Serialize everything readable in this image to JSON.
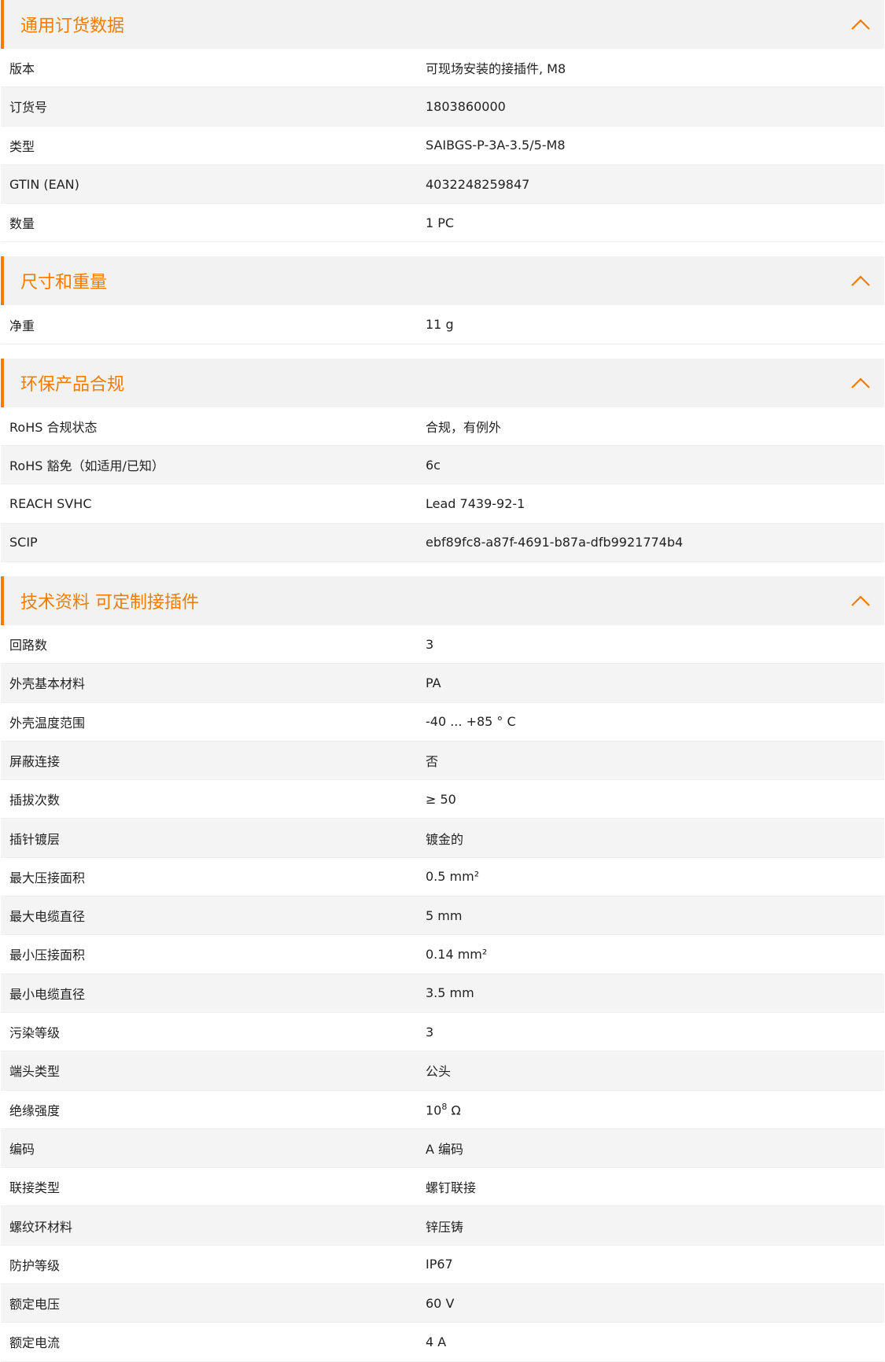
{
  "accent_color": "#f07c00",
  "sections": [
    {
      "title": "通用订货数据",
      "rows": [
        {
          "label": "版本",
          "value": "可现场安装的接插件, M8"
        },
        {
          "label": "订货号",
          "value": "1803860000"
        },
        {
          "label": "类型",
          "value": "SAIBGS-P-3A-3.5/5-M8"
        },
        {
          "label": "GTIN (EAN)",
          "value": "4032248259847"
        },
        {
          "label": "数量",
          "value": "1  PC"
        }
      ]
    },
    {
      "title": "尺寸和重量",
      "rows": [
        {
          "label": "净重",
          "value": "11  g"
        }
      ]
    },
    {
      "title": "环保产品合规",
      "rows": [
        {
          "label": "RoHS 合规状态",
          "value": "合规，有例外"
        },
        {
          "label": "RoHS 豁免（如适用/已知）",
          "value": "6c"
        },
        {
          "label": "REACH SVHC",
          "value": "Lead 7439-92-1"
        },
        {
          "label": "SCIP",
          "value": "ebf89fc8-a87f-4691-b87a-dfb9921774b4"
        }
      ]
    },
    {
      "title": "技术资料 可定制接插件",
      "rows": [
        {
          "label": "回路数",
          "value": "3"
        },
        {
          "label": "外壳基本材料",
          "value": "PA"
        },
        {
          "label": "外壳温度范围",
          "value": "-40 ... +85 ° C"
        },
        {
          "label": "屏蔽连接",
          "value": "否"
        },
        {
          "label": "插拔次数",
          "value": "≥ 50"
        },
        {
          "label": "插针镀层",
          "value": "镀金的"
        },
        {
          "label": "最大压接面积",
          "value": "0.5  mm²"
        },
        {
          "label": "最大电缆直径",
          "value": "5  mm"
        },
        {
          "label": "最小压接面积",
          "value": "0.14  mm²"
        },
        {
          "label": "最小电缆直径",
          "value": "3.5  mm"
        },
        {
          "label": "污染等级",
          "value": "3"
        },
        {
          "label": "端头类型",
          "value": "公头"
        },
        {
          "label": "绝缘强度",
          "value_base": "10",
          "value_exp": "8",
          "value_unit": " Ω"
        },
        {
          "label": "编码",
          "value": "A 编码"
        },
        {
          "label": "联接类型",
          "value": "螺钉联接"
        },
        {
          "label": "螺纹环材料",
          "value": "锌压铸"
        },
        {
          "label": "防护等级",
          "value": "IP67"
        },
        {
          "label": "额定电压",
          "value": "60  V"
        },
        {
          "label": "额定电流",
          "value": "4  A"
        }
      ]
    }
  ]
}
